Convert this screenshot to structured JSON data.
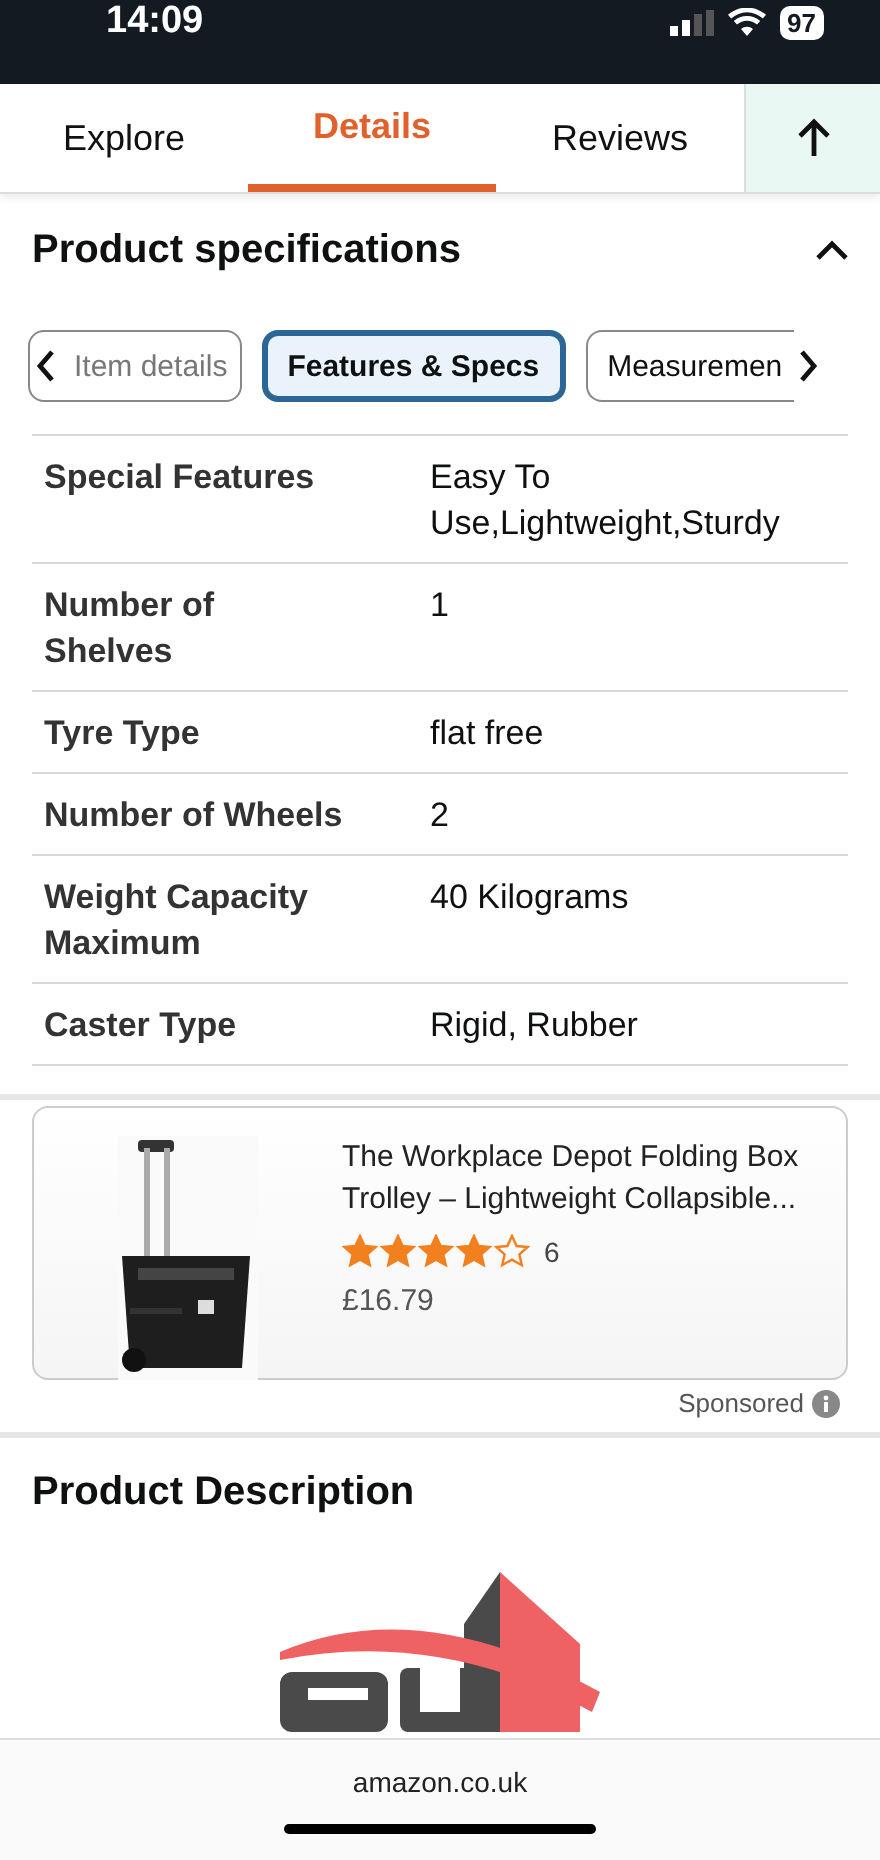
{
  "status_bar": {
    "time": "14:09",
    "battery": "97"
  },
  "tabs": [
    {
      "label": "Explore",
      "selected": false
    },
    {
      "label": "Details",
      "selected": true
    },
    {
      "label": "Reviews",
      "selected": false
    }
  ],
  "specifications": {
    "title": "Product specifications",
    "expanded": true,
    "chips": [
      {
        "label": "Item details",
        "selected": false
      },
      {
        "label": "Features & Specs",
        "selected": true
      },
      {
        "label": "Measuremen",
        "selected": false
      }
    ],
    "rows": [
      {
        "name": "Special Features",
        "value": "Easy To Use,Lightweight,Sturdy"
      },
      {
        "name": "Number of Shelves",
        "value": "1"
      },
      {
        "name": "Tyre Type",
        "value": "flat free"
      },
      {
        "name": "Number of Wheels",
        "value": "2"
      },
      {
        "name": "Weight Capacity Maximum",
        "value": "40 Kilograms"
      },
      {
        "name": "Caster Type",
        "value": "Rigid, Rubber"
      }
    ]
  },
  "sponsored_product": {
    "title": "The Workplace Depot Folding Box Trolley – Lightweight Collapsible...",
    "stars": 4,
    "rating_count": "6",
    "price": "£16.79",
    "label": "Sponsored"
  },
  "product_description": {
    "title": "Product Description"
  },
  "browser_bar": {
    "url": "amazon.co.uk"
  }
}
